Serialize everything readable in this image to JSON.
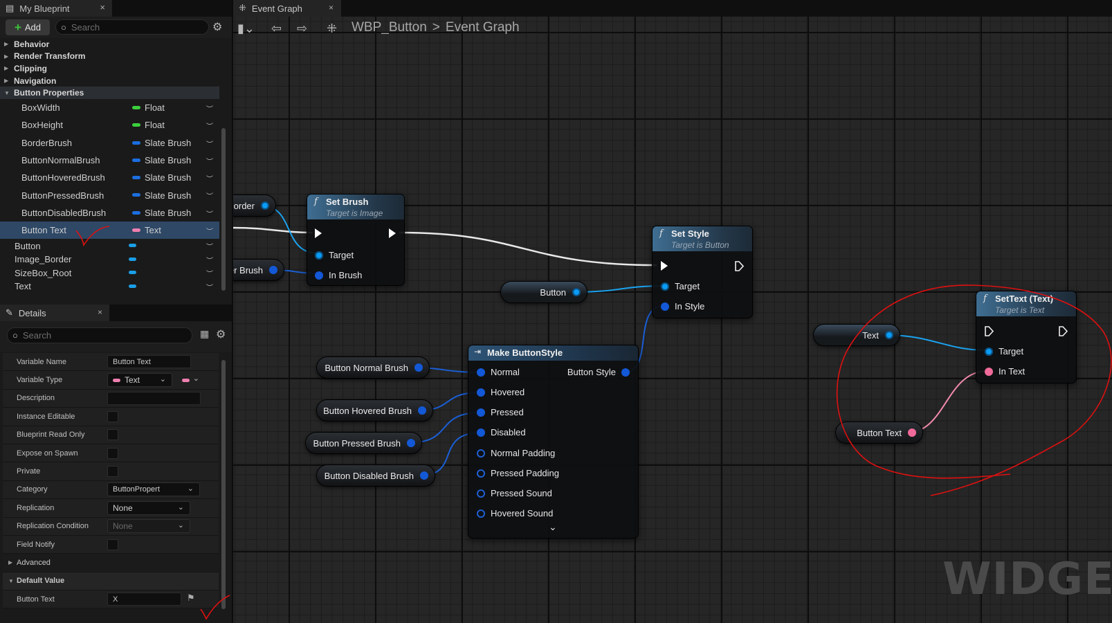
{
  "blueprint_panel": {
    "tab_title": "My Blueprint",
    "close_label": "×",
    "add_label": "Add",
    "search_placeholder": "Search",
    "categories_collapsed": [
      "Behavior",
      "Render Transform",
      "Clipping",
      "Navigation"
    ],
    "open_category": "Button Properties",
    "variables": [
      {
        "name": "BoxWidth",
        "type": "Float",
        "color": "#3ccf3c"
      },
      {
        "name": "BoxHeight",
        "type": "Float",
        "color": "#3ccf3c"
      },
      {
        "name": "BorderBrush",
        "type": "Slate Brush",
        "color": "#1c6ee0"
      },
      {
        "name": "ButtonNormalBrush",
        "type": "Slate Brush",
        "color": "#1c6ee0"
      },
      {
        "name": "ButtonHoveredBrush",
        "type": "Slate Brush",
        "color": "#1c6ee0"
      },
      {
        "name": "ButtonPressedBrush",
        "type": "Slate Brush",
        "color": "#1c6ee0"
      },
      {
        "name": "ButtonDisabledBrush",
        "type": "Slate Brush",
        "color": "#1c6ee0"
      },
      {
        "name": "Button Text",
        "type": "Text",
        "color": "#ef7fb0"
      }
    ],
    "widget_variables": [
      "Button",
      "Image_Border",
      "SizeBox_Root",
      "Text"
    ]
  },
  "details_panel": {
    "tab_title": "Details",
    "close_label": "×",
    "search_placeholder": "Search",
    "variable_name_label": "Variable Name",
    "variable_name_value": "Button Text",
    "variable_type_label": "Variable Type",
    "variable_type_value": "Text",
    "description_label": "Description",
    "instance_editable_label": "Instance Editable",
    "read_only_label": "Blueprint Read Only",
    "expose_label": "Expose on Spawn",
    "private_label": "Private",
    "category_label": "Category",
    "category_value": "ButtonPropert",
    "replication_label": "Replication",
    "replication_value": "None",
    "rep_condition_label": "Replication Condition",
    "rep_condition_value": "None",
    "field_notify_label": "Field Notify",
    "advanced_label": "Advanced",
    "default_value_label": "Default Value",
    "default_button_text_label": "Button Text",
    "default_button_text_value": "X"
  },
  "graph": {
    "tab_title": "Event Graph",
    "close_label": "×",
    "breadcrumb_root": "WBP_Button",
    "breadcrumb_sep": ">",
    "breadcrumb_current": "Event Graph",
    "watermark": "WIDGET",
    "set_brush": {
      "func_glyph": "f",
      "title": "Set Brush",
      "subtitle": "Target is Image",
      "pin_target": "Target",
      "pin_in": "In Brush"
    },
    "set_style": {
      "func_glyph": "f",
      "title": "Set Style",
      "subtitle": "Target is Button",
      "pin_target": "Target",
      "pin_in": "In Style"
    },
    "set_text": {
      "func_glyph": "f",
      "title": "SetText (Text)",
      "subtitle": "Target is Text",
      "pin_target": "Target",
      "pin_in": "In Text"
    },
    "make_style": {
      "title": "Make ButtonStyle",
      "output": "Button Style",
      "chevron": "⌄",
      "pins": [
        "Normal",
        "Hovered",
        "Pressed",
        "Disabled",
        "Normal Padding",
        "Pressed Padding",
        "Pressed Sound",
        "Hovered Sound"
      ]
    },
    "getters": {
      "border_partial": "order",
      "brush_partial": "er Brush",
      "button": "Button",
      "normal_brush": "Button Normal Brush",
      "hovered_brush": "Button Hovered Brush",
      "pressed_brush": "Button Pressed Brush",
      "disabled_brush": "Button Disabled Brush",
      "text": "Text",
      "button_text": "Button Text"
    }
  },
  "colors": {
    "accent_blue": "#0a9cf5",
    "text_pin": "#f06a9a",
    "annotation_red": "#e01010",
    "selection": "#2e4866"
  }
}
